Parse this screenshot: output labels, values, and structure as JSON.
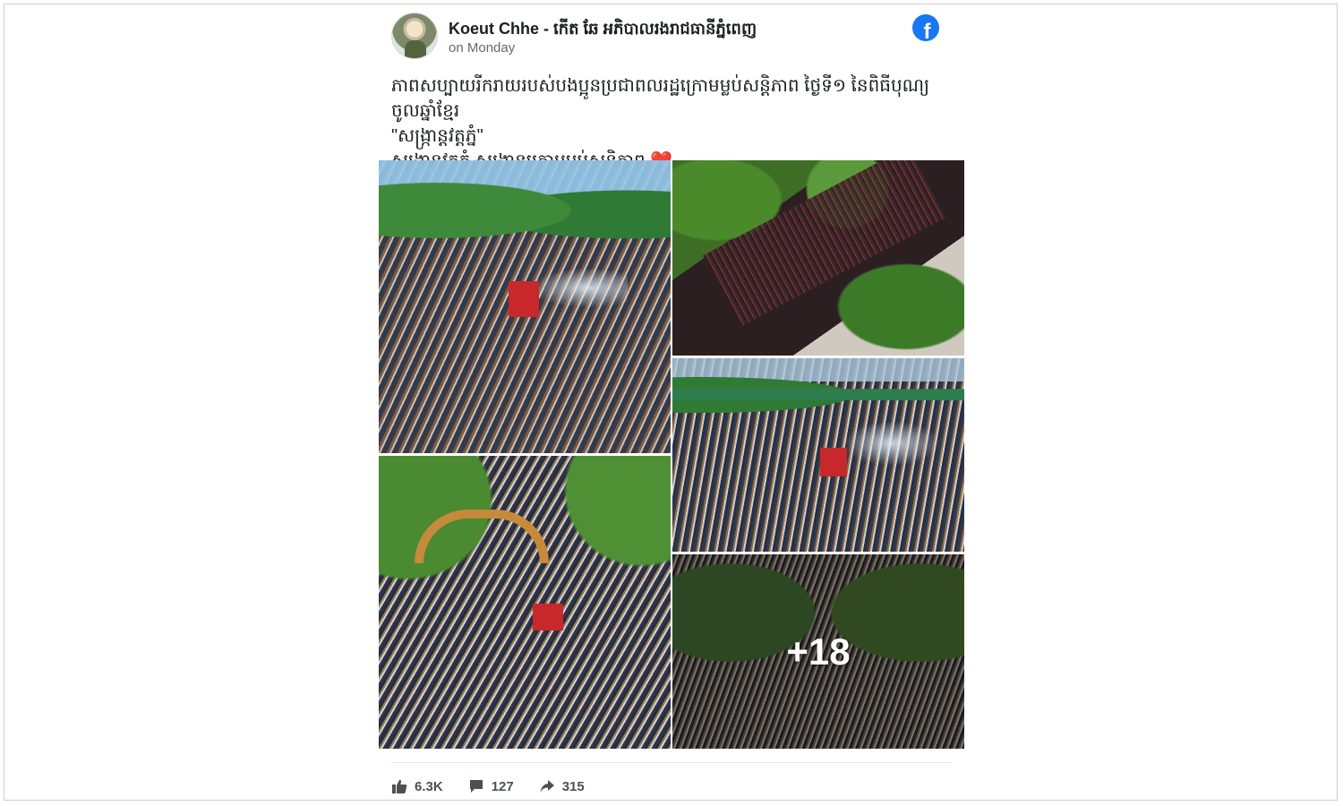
{
  "post": {
    "author": "Koeut Chhe - កើត ឆែ អភិបាលរងរាជធានីភ្នំពេញ",
    "time": "on Monday",
    "caption_line1": "ភាពសប្បាយរីករាយរបស់បងប្អូនប្រជាពលរដ្ឋក្រោមម្លប់សន្តិភាព ថ្ងៃទី១ នៃពិធីបុណ្យចូលឆ្នាំខ្មែរ",
    "caption_line2": "\"សង្ក្រាន្តវត្តភ្នំ\"",
    "caption_line3": "សង្ក្រាន្តវត្តភ្នំ សង្ក្រាន្តក្រោមម្លប់សន្តិភាព",
    "platform_logo": "facebook-icon"
  },
  "photos": {
    "more_count": "+18"
  },
  "stats": {
    "likes": "6.3K",
    "comments": "127",
    "shares": "315"
  },
  "colors": {
    "brand": "#1877f2",
    "text": "#1c1e21",
    "muted": "#65676b",
    "heart": "#e0245e"
  }
}
